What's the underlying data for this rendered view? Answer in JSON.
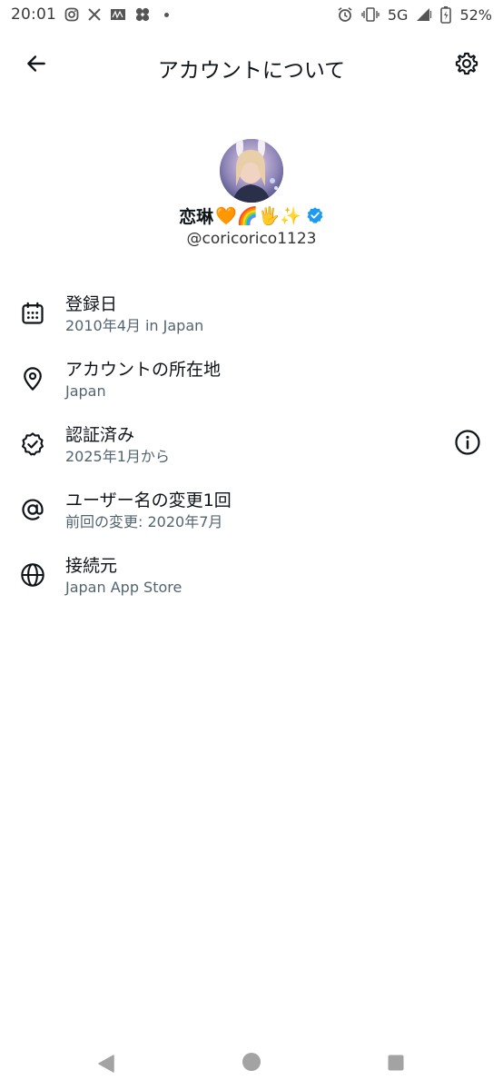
{
  "status_bar": {
    "time": "20:01",
    "network": "5G",
    "battery": "52%",
    "icons_left": [
      "instagram-icon",
      "x-icon",
      "news-icon",
      "fan-icon",
      "dot-icon"
    ],
    "icons_right": [
      "alarm-icon",
      "vibrate-icon",
      "signal-icon",
      "battery-icon"
    ]
  },
  "header": {
    "title": "アカウントについて",
    "back_icon": "arrow-left-icon",
    "settings_icon": "gear-icon"
  },
  "profile": {
    "display_name": "恋琳",
    "name_emojis": "🧡🌈🖐✨",
    "handle": "@coricorico1123",
    "verified": true,
    "verified_color": "#1d9bf0"
  },
  "info_items": [
    {
      "icon": "calendar-icon",
      "title": "登録日",
      "subtitle": "2010年4月 in Japan"
    },
    {
      "icon": "location-pin-icon",
      "title": "アカウントの所在地",
      "subtitle": "Japan"
    },
    {
      "icon": "verified-check-icon",
      "title": "認証済み",
      "subtitle": "2025年1月から",
      "extra_icon": "info-icon"
    },
    {
      "icon": "at-sign-icon",
      "title": "ユーザー名の変更1回",
      "subtitle": "前回の変更: 2020年7月"
    },
    {
      "icon": "globe-icon",
      "title": "接続元",
      "subtitle": "Japan App Store"
    }
  ],
  "colors": {
    "text_primary": "#0f1419",
    "text_secondary": "#536471",
    "accent": "#1d9bf0",
    "nav_icons": "#a3a3a3"
  },
  "nav_bar": {
    "icons": [
      "nav-back-icon",
      "nav-home-icon",
      "nav-recents-icon"
    ]
  }
}
